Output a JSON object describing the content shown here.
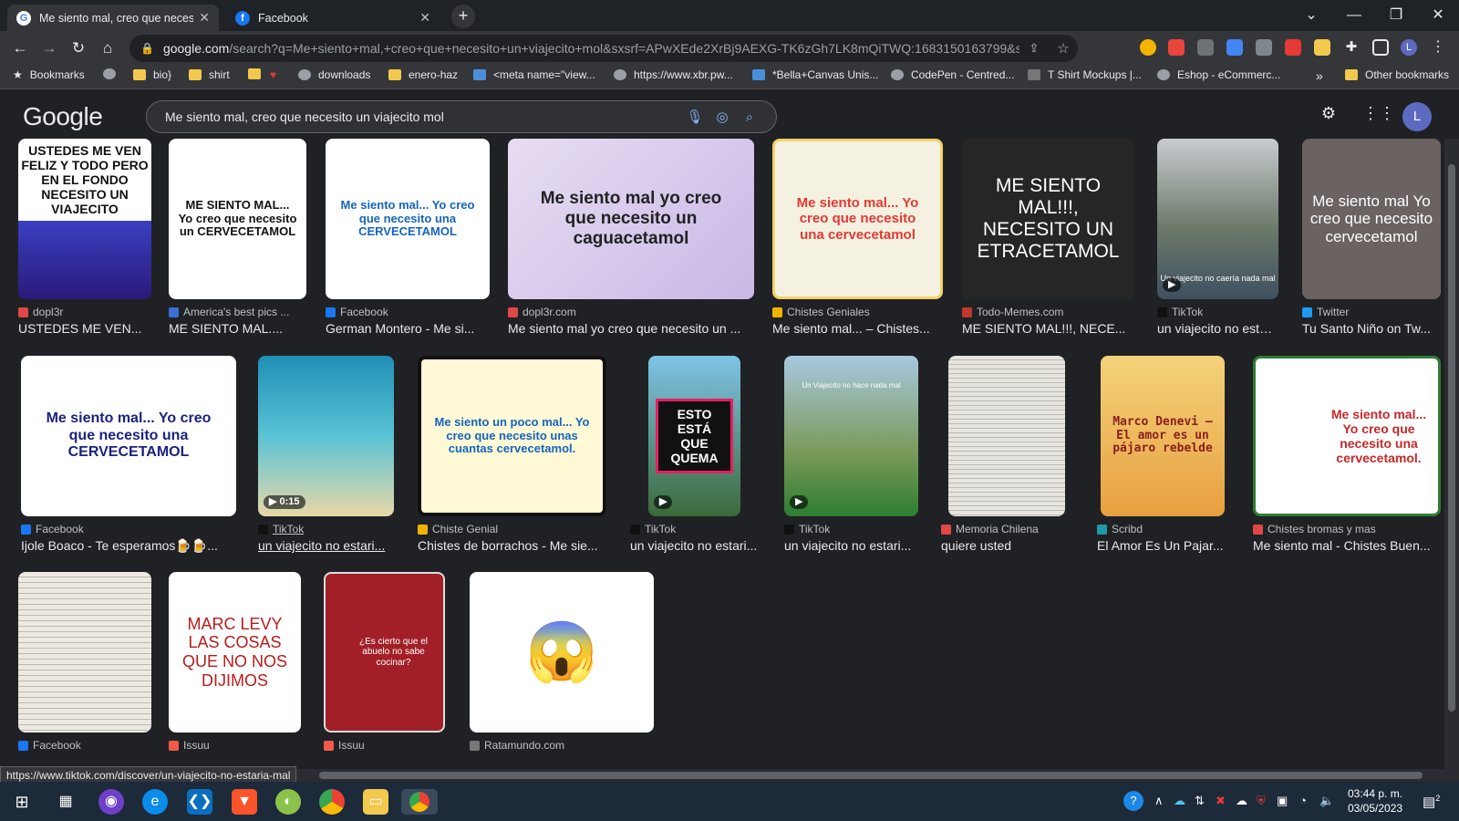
{
  "tabs": [
    {
      "title": "Me siento mal, creo que necesito",
      "icon": "google-icon",
      "close": "✕"
    },
    {
      "title": "Facebook",
      "icon": "facebook-icon",
      "close": "✕"
    }
  ],
  "new_tab": "+",
  "address": {
    "host": "google.com",
    "path": "/search?q=Me+siento+mal,+creo+que+necesito+un+viajecito+mol&sxsrf=APwXEde2XrBj9AEXG-TK6zGh7LK8mQiTWQ:1683150163799&source=l..."
  },
  "bookmarks": [
    {
      "label": "Bookmarks",
      "color": "#e8eaed"
    },
    {
      "label": "",
      "color": "#9aa0a6"
    },
    {
      "label": "bio}",
      "color": "#f2c94c"
    },
    {
      "label": "shirt",
      "color": "#f2c94c"
    },
    {
      "label": "",
      "color": "#f2c94c"
    },
    {
      "label": "",
      "color": "#e53935"
    },
    {
      "label": "downloads",
      "color": "#9aa0a6"
    },
    {
      "label": "enero-haz",
      "color": "#f2c94c"
    },
    {
      "label": "<meta name=\"view...",
      "color": "#4a90d9"
    },
    {
      "label": "https://www.xbr.pw...",
      "color": "#9aa0a6"
    },
    {
      "label": "*Bella+Canvas Unis...",
      "color": "#4a90d9"
    },
    {
      "label": "CodePen - Centred...",
      "color": "#9aa0a6"
    },
    {
      "label": "T Shirt Mockups |...",
      "color": "#777"
    },
    {
      "label": "Eshop - eCommerc...",
      "color": "#9aa0a6"
    }
  ],
  "bookmarks_more": "»",
  "other_bookmarks": "Other bookmarks",
  "google": {
    "logo": "Google",
    "query": "Me siento mal, creo que necesito un viajecito mol",
    "avatar": "L"
  },
  "results": [
    {
      "source": "dopl3r",
      "title": "USTEDES ME VEN...",
      "thumb": "USTEDES ME VEN FELIZ Y TODO PERO EN EL FONDO NECESITO UN VIAJECITO",
      "src_color": "#e04848"
    },
    {
      "source": "America's best pics ...",
      "title": "ME SIENTO MAL....",
      "thumb": "ME SIENTO MAL... Yo creo que necesito un CERVECETAMOL",
      "src_color": "#3b6fd4"
    },
    {
      "source": "Facebook",
      "title": "German Montero - Me si...",
      "thumb": "Me siento mal... Yo creo que necesito una CERVECETAMOL",
      "src_color": "#1877f2"
    },
    {
      "source": "dopl3r.com",
      "title": "Me siento mal yo creo que necesito un ...",
      "thumb": "Me siento mal yo creo que necesito un caguacetamol",
      "src_color": "#e04848"
    },
    {
      "source": "Chistes Geniales",
      "title": "Me siento mal... – Chistes...",
      "thumb": "Me siento mal... Yo creo que necesito una cervecetamol",
      "src_color": "#f2b300"
    },
    {
      "source": "Todo-Memes.com",
      "title": "ME SIENTO MAL!!!, NECE...",
      "thumb": "ME SIENTO MAL!!!, NECESITO UN ETRACETAMOL",
      "src_color": "#c0392b"
    },
    {
      "source": "TikTok",
      "title": "un viajecito no estar...",
      "thumb": "Un viajecito no caería nada mal",
      "src_color": "#111"
    },
    {
      "source": "Twitter",
      "title": "Tu Santo Niño on Tw...",
      "thumb": "Me siento mal Yo creo que necesito cervecetamol",
      "src_color": "#1d9bf0"
    },
    {
      "source": "Facebook",
      "title": "Ijole Boaco - Te esperamos🍺🍺...",
      "thumb": "Me siento mal... Yo creo que necesito una CERVECETAMOL",
      "src_color": "#1877f2"
    },
    {
      "source": "TikTok",
      "title": "un viajecito no estari...",
      "thumb": "",
      "badge": "▶ 0:15",
      "src_color": "#111"
    },
    {
      "source": "Chiste Genial",
      "title": "Chistes de borrachos - Me sie...",
      "thumb": "Me siento un poco mal... Yo creo que necesito unas cuantas cervecetamol.",
      "src_color": "#f2b300"
    },
    {
      "source": "TikTok",
      "title": "un viajecito no estari...",
      "thumb": "ESTO ESTÁ QUE QUEMA",
      "badge": "▶",
      "src_color": "#111"
    },
    {
      "source": "TikTok",
      "title": "un viajecito no estari...",
      "thumb": "Un Viajecito no hace nada mal",
      "badge": "▶",
      "src_color": "#111"
    },
    {
      "source": "Memoria Chilena",
      "title": "quiere usted",
      "thumb": "",
      "src_color": "#e04848"
    },
    {
      "source": "Scribd",
      "title": "El Amor Es Un Pajar...",
      "thumb": "Marco Denevi — El amor es un pájaro rebelde",
      "src_color": "#1e9aa8"
    },
    {
      "source": "Chistes bromas y mas",
      "title": "Me siento mal - Chistes Buen...",
      "thumb": "Me siento mal... Yo creo que necesito una cervecetamol.",
      "src_color": "#e04848"
    },
    {
      "source": "Facebook",
      "title": "",
      "thumb": "",
      "src_color": "#1877f2"
    },
    {
      "source": "Issuu",
      "title": "",
      "thumb": "MARC LEVY LAS COSAS QUE NO NOS DIJIMOS",
      "src_color": "#f15a4a"
    },
    {
      "source": "Issuu",
      "title": "",
      "thumb": "¿Es cierto que el abuelo no sabe cocinar?",
      "src_color": "#f15a4a"
    },
    {
      "source": "Ratamundo.com",
      "title": "",
      "thumb": "😱",
      "src_color": "#777"
    }
  ],
  "status_url": "https://www.tiktok.com/discover/un-viajecito-no-estaria-mal",
  "clock": {
    "time": "03:44 p. m.",
    "date": "03/05/2023"
  },
  "notifications": "2"
}
